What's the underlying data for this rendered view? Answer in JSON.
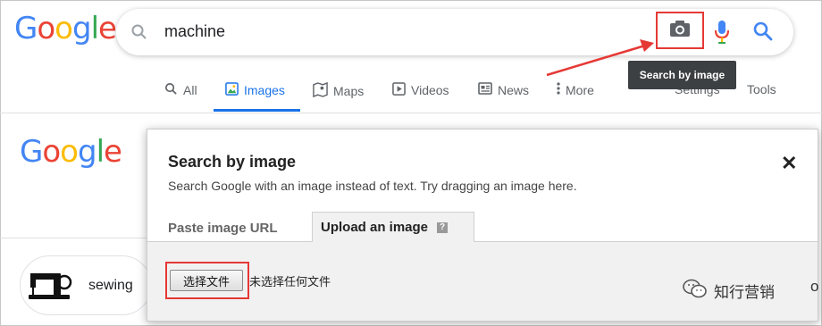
{
  "brand": {
    "logo_letters": [
      "G",
      "o",
      "o",
      "g",
      "l",
      "e"
    ],
    "colors": {
      "blue": "#4285f4",
      "red": "#ea4335",
      "yellow": "#fbbc05",
      "green": "#34a853",
      "highlight": "#e53935"
    }
  },
  "search": {
    "query": "machine"
  },
  "tooltip": {
    "text": "Search by image"
  },
  "nav": {
    "tabs": [
      {
        "label": "All",
        "icon": "search-icon"
      },
      {
        "label": "Images",
        "icon": "image-icon",
        "active": true
      },
      {
        "label": "Maps",
        "icon": "map-pin-icon"
      },
      {
        "label": "Videos",
        "icon": "play-icon"
      },
      {
        "label": "News",
        "icon": "newspaper-icon"
      },
      {
        "label": "More",
        "icon": "more-vertical-icon"
      }
    ],
    "settings": "Settings",
    "tools": "Tools"
  },
  "chip": {
    "label": "sewing"
  },
  "modal": {
    "title": "Search by image",
    "subtitle": "Search Google with an image instead of text. Try dragging an image here.",
    "tab_paste": "Paste image URL",
    "tab_upload": "Upload an image",
    "help_glyph": "?",
    "file_button": "选择文件",
    "file_status": "未选择任何文件",
    "close_glyph": "✕"
  },
  "watermark": {
    "text": "知行营销"
  },
  "edge_glyph": "o"
}
